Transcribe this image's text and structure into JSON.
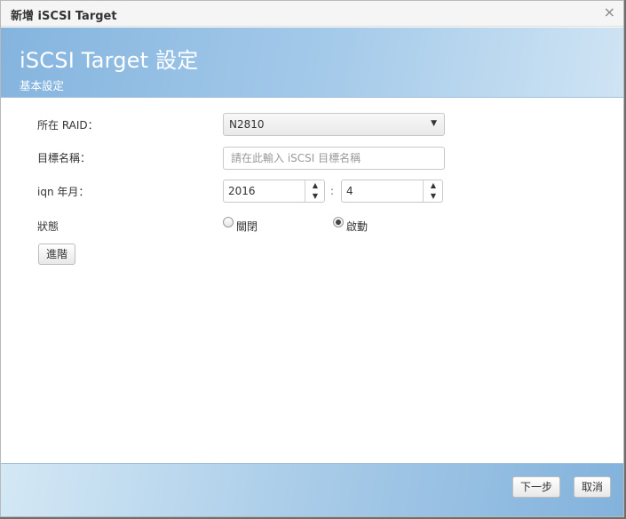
{
  "dialog": {
    "title": "新增 iSCSI Target",
    "close_glyph": "×"
  },
  "banner": {
    "heading": "iSCSI Target 設定",
    "subheading": "基本設定"
  },
  "form": {
    "raid": {
      "label": "所在 RAID：",
      "value": "N2810"
    },
    "target_name": {
      "label": "目標名稱：",
      "placeholder": "請在此輸入 iSCSI 目標名稱"
    },
    "iqn": {
      "label": "iqn 年月：",
      "year": "2016",
      "separator": ":",
      "month": "4"
    },
    "status": {
      "label": "狀態",
      "options": [
        {
          "label": "關閉",
          "checked": false
        },
        {
          "label": "啟動",
          "checked": true
        }
      ]
    },
    "advanced_label": "進階"
  },
  "footer": {
    "next_label": "下一步",
    "cancel_label": "取消"
  }
}
